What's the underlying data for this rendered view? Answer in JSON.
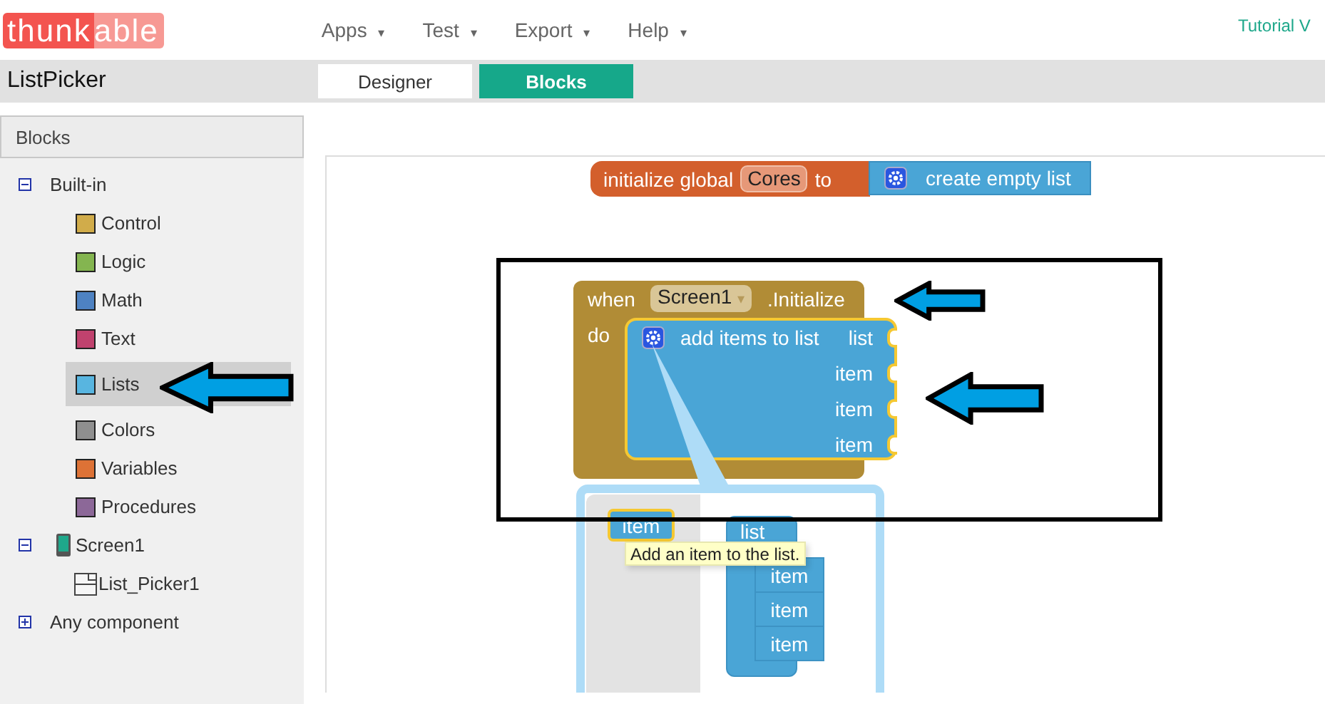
{
  "app_bar": {
    "logo": [
      "thunk",
      "able"
    ],
    "menus": [
      {
        "label": "Apps",
        "caret": "▾"
      },
      {
        "label": "Test",
        "caret": "▾"
      },
      {
        "label": "Export",
        "caret": "▾"
      },
      {
        "label": "Help",
        "caret": "▾"
      }
    ],
    "link": "Tutorial V"
  },
  "project": {
    "name": "ListPicker",
    "tabs": [
      {
        "label": "Designer",
        "selected": false
      },
      {
        "label": "Blocks",
        "selected": true
      }
    ]
  },
  "blocks_panel": {
    "title": "Blocks",
    "tree": [
      {
        "label": "Built-in",
        "kind": "group",
        "expanded": true,
        "children": [
          {
            "label": "Control",
            "kind": "category",
            "color": "#d1ac4a",
            "selected": false
          },
          {
            "label": "Logic",
            "kind": "category",
            "color": "#84b550",
            "selected": false
          },
          {
            "label": "Math",
            "kind": "category",
            "color": "#4e82c2",
            "selected": false
          },
          {
            "label": "Text",
            "kind": "category",
            "color": "#c0426e",
            "selected": false
          },
          {
            "label": "Lists",
            "kind": "category",
            "color": "#58b5e0",
            "selected": true
          },
          {
            "label": "Colors",
            "kind": "category",
            "color": "#8f8f8f",
            "selected": false
          },
          {
            "label": "Variables",
            "kind": "category",
            "color": "#dd7236",
            "selected": false
          },
          {
            "label": "Procedures",
            "kind": "category",
            "color": "#8c6898",
            "selected": false
          }
        ]
      },
      {
        "label": "Screen1",
        "kind": "screen",
        "expanded": true,
        "children": [
          {
            "label": "List_Picker1",
            "kind": "component"
          }
        ]
      },
      {
        "label": "Any component",
        "kind": "group",
        "expanded": false
      }
    ]
  },
  "workspace": {
    "blocks": [
      {
        "kind": "global_init",
        "label": "initialize global",
        "name": "Cores",
        "to": "to",
        "value": {
          "kind": "list_create",
          "label": "create empty list"
        }
      },
      {
        "kind": "event",
        "when": "when",
        "component": "Screen1",
        "caret": "▾",
        "event": ".Initialize",
        "do": "do",
        "statement": {
          "label": "add items to list",
          "sockets": [
            "list",
            "item",
            "item",
            "item"
          ]
        }
      }
    ],
    "mutator": {
      "palette": [
        "item"
      ],
      "container": "list",
      "items": [
        "item",
        "item",
        "item"
      ],
      "tooltip": "Add an item to the list."
    }
  }
}
